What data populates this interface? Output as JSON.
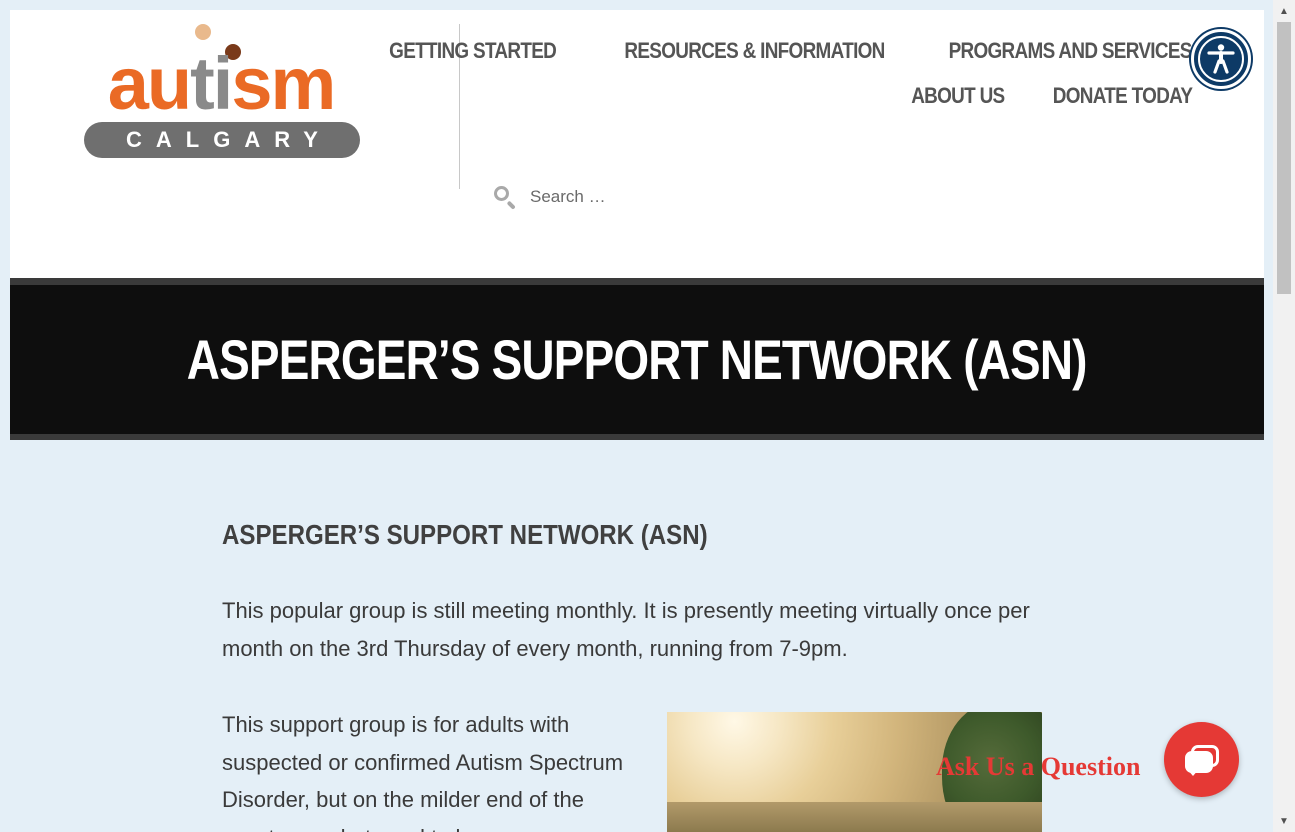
{
  "header": {
    "logo": {
      "word": "autism",
      "subword": "CALGARY"
    },
    "nav": {
      "row1": [
        "GETTING STARTED",
        "RESOURCES & INFORMATION",
        "PROGRAMS AND SERVICES"
      ],
      "row2": [
        "ABOUT US",
        "DONATE TODAY"
      ]
    },
    "search": {
      "placeholder": "Search …",
      "icon": "search-icon"
    },
    "accessibility": {
      "icon": "accessibility-icon"
    }
  },
  "hero": {
    "title": "ASPERGER’S SUPPORT NETWORK (ASN)"
  },
  "content": {
    "heading": "ASPERGER’S SUPPORT NETWORK (ASN)",
    "intro": "This popular group is still meeting monthly. It is presently meeting virtually once per month on the 3rd Thursday of every month, running from 7-9pm.",
    "side_text": "This support group is for adults with suspected or confirmed Autism Spectrum Disorder, but on the milder end of the spectrum, what used to be"
  },
  "chat": {
    "label": "Ask Us a Question",
    "icon": "chat-bubbles-icon"
  },
  "colors": {
    "brand_orange": "#ea6a25",
    "brand_gray": "#6f6f6f",
    "accent_red": "#e53935",
    "access_blue": "#0d3a66",
    "hero_bg": "#0e0e0e",
    "page_bg": "#e4eff7"
  }
}
